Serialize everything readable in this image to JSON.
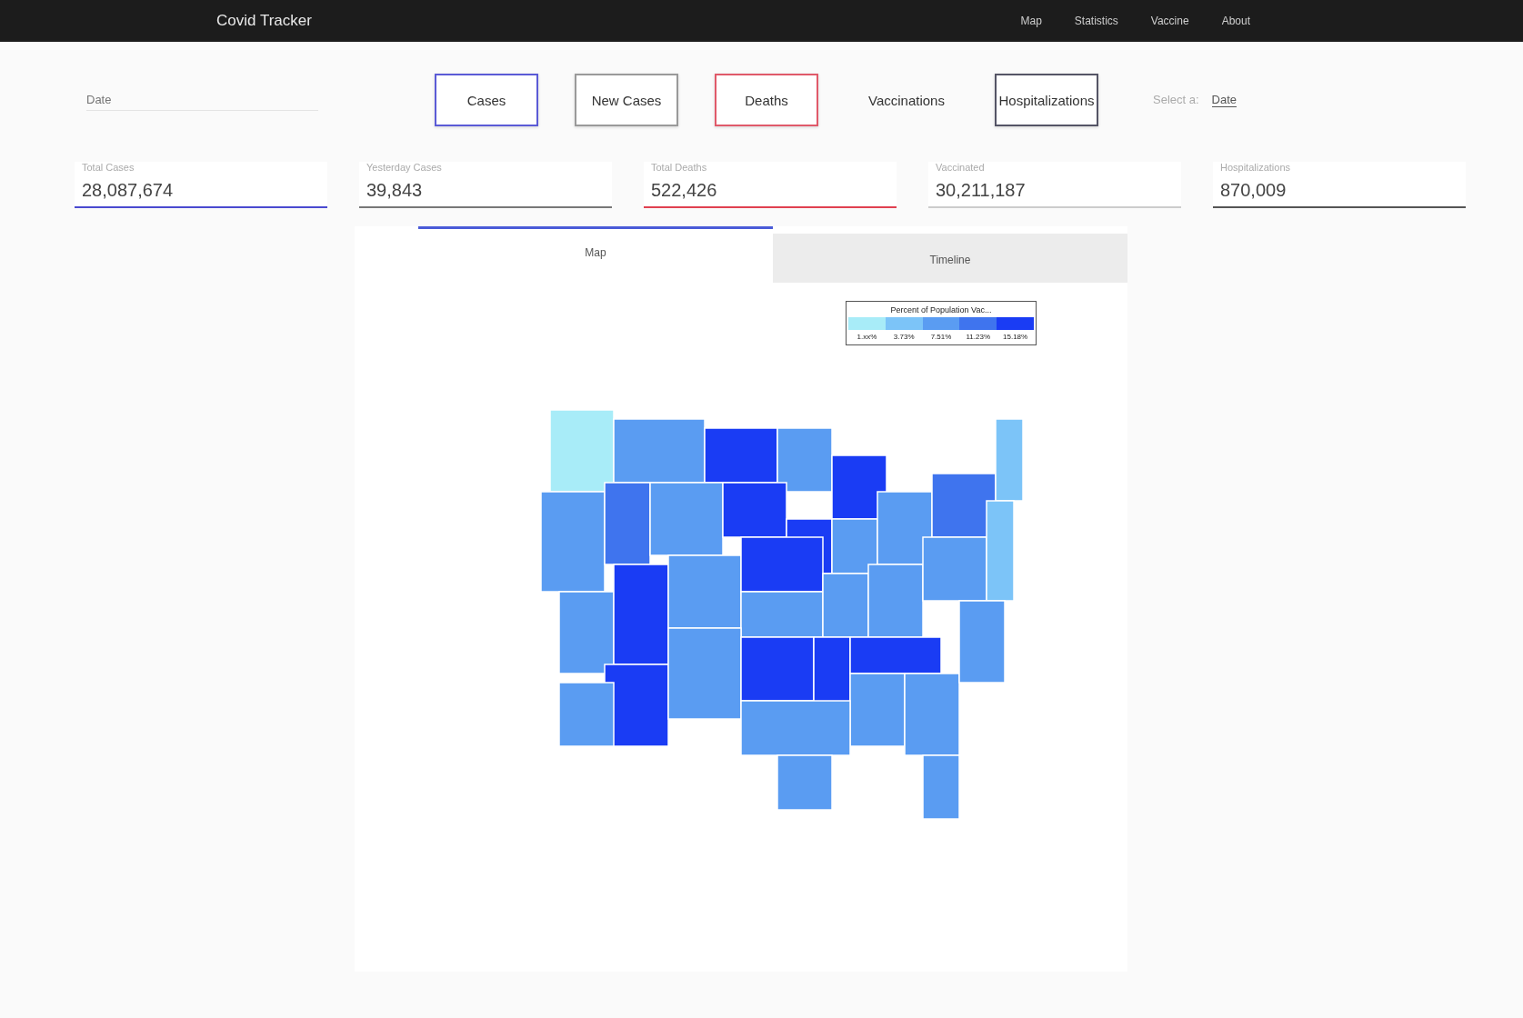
{
  "app_bar": {
    "title": "Covid Tracker",
    "nav": [
      "Map",
      "Statistics",
      "Vaccine",
      "About"
    ]
  },
  "date_field": {
    "placeholder": "Date"
  },
  "metric_buttons": [
    {
      "label": "Cases",
      "kind": "outlined",
      "color": "#5b5bd6"
    },
    {
      "label": "New Cases",
      "kind": "outlined",
      "color": "#9a9a9a"
    },
    {
      "label": "Deaths",
      "kind": "outlined",
      "color": "#e05a6a"
    },
    {
      "label": "Vaccinations",
      "kind": "plain"
    },
    {
      "label": "Hospitalizations",
      "kind": "outlined",
      "color": "#555566"
    }
  ],
  "select": {
    "label": "Select a:",
    "value": "Date"
  },
  "stats": [
    {
      "label": "Total Cases",
      "value": "28,087,674",
      "color": "#4a4ad0"
    },
    {
      "label": "Yesterday Cases",
      "value": "39,843",
      "color": "#777777"
    },
    {
      "label": "Total Deaths",
      "value": "522,426",
      "color": "#e04050"
    },
    {
      "label": "Vaccinated",
      "value": "30,211,187",
      "color": "#cccccc"
    },
    {
      "label": "Hospitalizations",
      "value": "870,009",
      "color": "#555555"
    }
  ],
  "view_tabs": [
    {
      "label": "Map",
      "selected": true
    },
    {
      "label": "Timeline",
      "selected": false
    }
  ],
  "legend": {
    "title": "Percent of Population Vac...",
    "steps": [
      {
        "label": "1.xx%",
        "color": "#a8ecf8"
      },
      {
        "label": "3.73%",
        "color": "#7cc4f8"
      },
      {
        "label": "7.51%",
        "color": "#5a9cf2"
      },
      {
        "label": "11.23%",
        "color": "#3f74ee"
      },
      {
        "label": "15.18%",
        "color": "#1a3cf4"
      }
    ]
  }
}
